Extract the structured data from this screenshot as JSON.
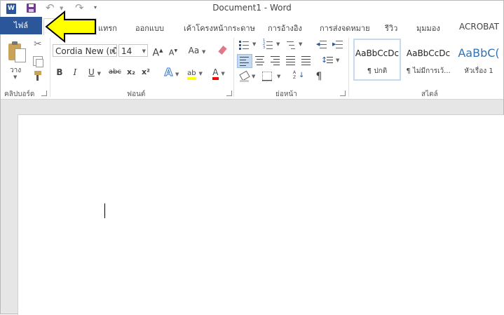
{
  "window": {
    "title": "Document1 - Word"
  },
  "quick_access": {
    "icons": [
      "word-icon",
      "save-icon",
      "undo-icon",
      "redo-icon",
      "customize-icon"
    ]
  },
  "tabs": [
    {
      "label": "ไฟล์"
    },
    {
      "label": ""
    },
    {
      "label": "แทรก"
    },
    {
      "label": "ออกแบบ"
    },
    {
      "label": "เค้าโครงหน้ากระดาษ"
    },
    {
      "label": "การอ้างอิง"
    },
    {
      "label": "การส่งจดหมาย"
    },
    {
      "label": "รีวิว"
    },
    {
      "label": "มุมมอง"
    },
    {
      "label": "ACROBAT"
    }
  ],
  "ribbon": {
    "clipboard": {
      "paste_label": "วาง",
      "group_label": "คลิปบอร์ด"
    },
    "font": {
      "font_name": "Cordia New (เนื",
      "font_size": "14",
      "group_label": "ฟอนต์",
      "bold": "B",
      "italic": "I",
      "underline": "U",
      "strike": "abc",
      "subscript": "x₂",
      "superscript": "x²",
      "grow": "A",
      "shrink": "A",
      "case": "Aa",
      "effects": "A",
      "highlight": "ab",
      "color": "A",
      "highlight_color": "#ffff00",
      "font_color": "#ff0000"
    },
    "paragraph": {
      "group_label": "ย่อหน้า",
      "pilcrow": "¶"
    },
    "styles": {
      "group_label": "สไตล์",
      "items": [
        {
          "sample": "AaBbCcDc",
          "name": "¶ ปกติ",
          "selected": true
        },
        {
          "sample": "AaBbCcDc",
          "name": "¶ ไม่มีการเว้...",
          "selected": false
        },
        {
          "sample": "AaBbC(",
          "name": "หัวเรื่อง 1",
          "selected": false
        }
      ]
    }
  },
  "colors": {
    "file_tab_bg": "#2b579a",
    "arrow_fill": "#ffff00"
  }
}
